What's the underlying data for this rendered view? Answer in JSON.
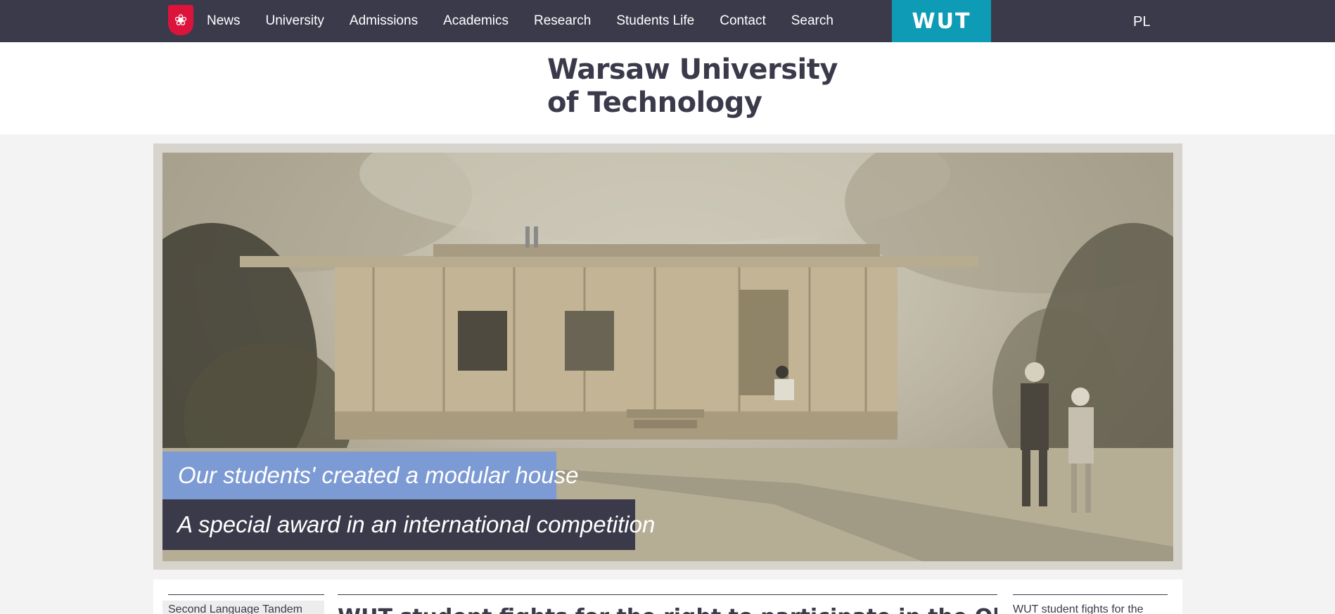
{
  "header": {
    "emblem_icon": "polish-eagle-emblem-icon",
    "nav_items": [
      {
        "label": "News"
      },
      {
        "label": "University"
      },
      {
        "label": "Admissions"
      },
      {
        "label": "Academics"
      },
      {
        "label": "Research"
      },
      {
        "label": "Students Life"
      },
      {
        "label": "Contact"
      },
      {
        "label": "Search"
      }
    ],
    "logo_text": "WUT",
    "language_switch": "PL",
    "colors": {
      "bar_background": "#3b3a4b",
      "logo_background": "#0e9bb5",
      "emblem_red": "#dc143c"
    }
  },
  "title_band": {
    "line1": "Warsaw University",
    "line2": "of Technology"
  },
  "hero": {
    "caption_primary": "Our students' created a modular house",
    "caption_secondary": "A special award in an international competition",
    "colors": {
      "caption_primary_bg": "#7c9ad3",
      "caption_secondary_bg": "#3b3a4b"
    }
  },
  "news_strip": {
    "left_item": "Second Language Tandem",
    "center_headline": "WUT student fights for the right to participate in the Olympic G",
    "right_item": "WUT student fights for the"
  }
}
